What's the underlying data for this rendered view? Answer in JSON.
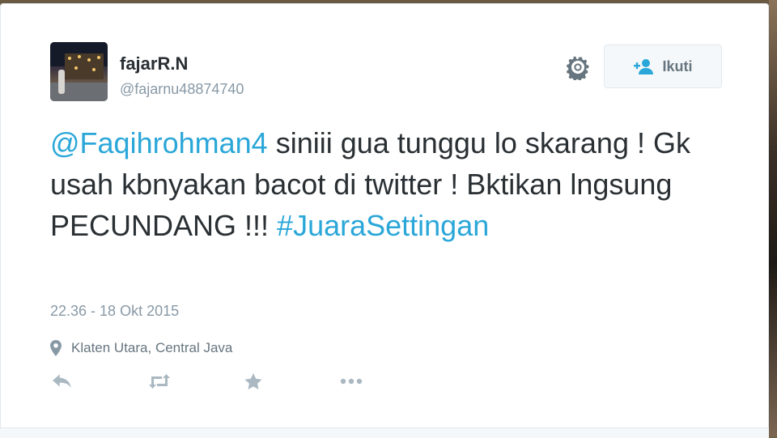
{
  "tweet": {
    "author": {
      "name": "fajarR.N",
      "handle": "@fajarnu48874740"
    },
    "follow_label": "Ikuti",
    "text": {
      "mention": "@Faqihrohman4",
      "body": " siniii gua tunggu lo skarang ! Gk usah kbnyakan bacot di twitter ! Bktikan lngsung PECUNDANG !!! ",
      "hashtag": "#JuaraSettingan"
    },
    "timestamp": "22.36 - 18 Okt 2015",
    "location": "Klaten Utara, Central Java",
    "icons": {
      "settings": "gear-icon",
      "follow": "add-user-icon",
      "location": "map-pin-icon",
      "reply": "reply-icon",
      "retweet": "retweet-icon",
      "favorite": "star-icon",
      "more": "more-dots-icon"
    }
  },
  "colors": {
    "link": "#2aa7d8",
    "text": "#292f33",
    "muted": "#8899a6",
    "icon": "#66757f",
    "action_icon": "#aab8c2"
  }
}
